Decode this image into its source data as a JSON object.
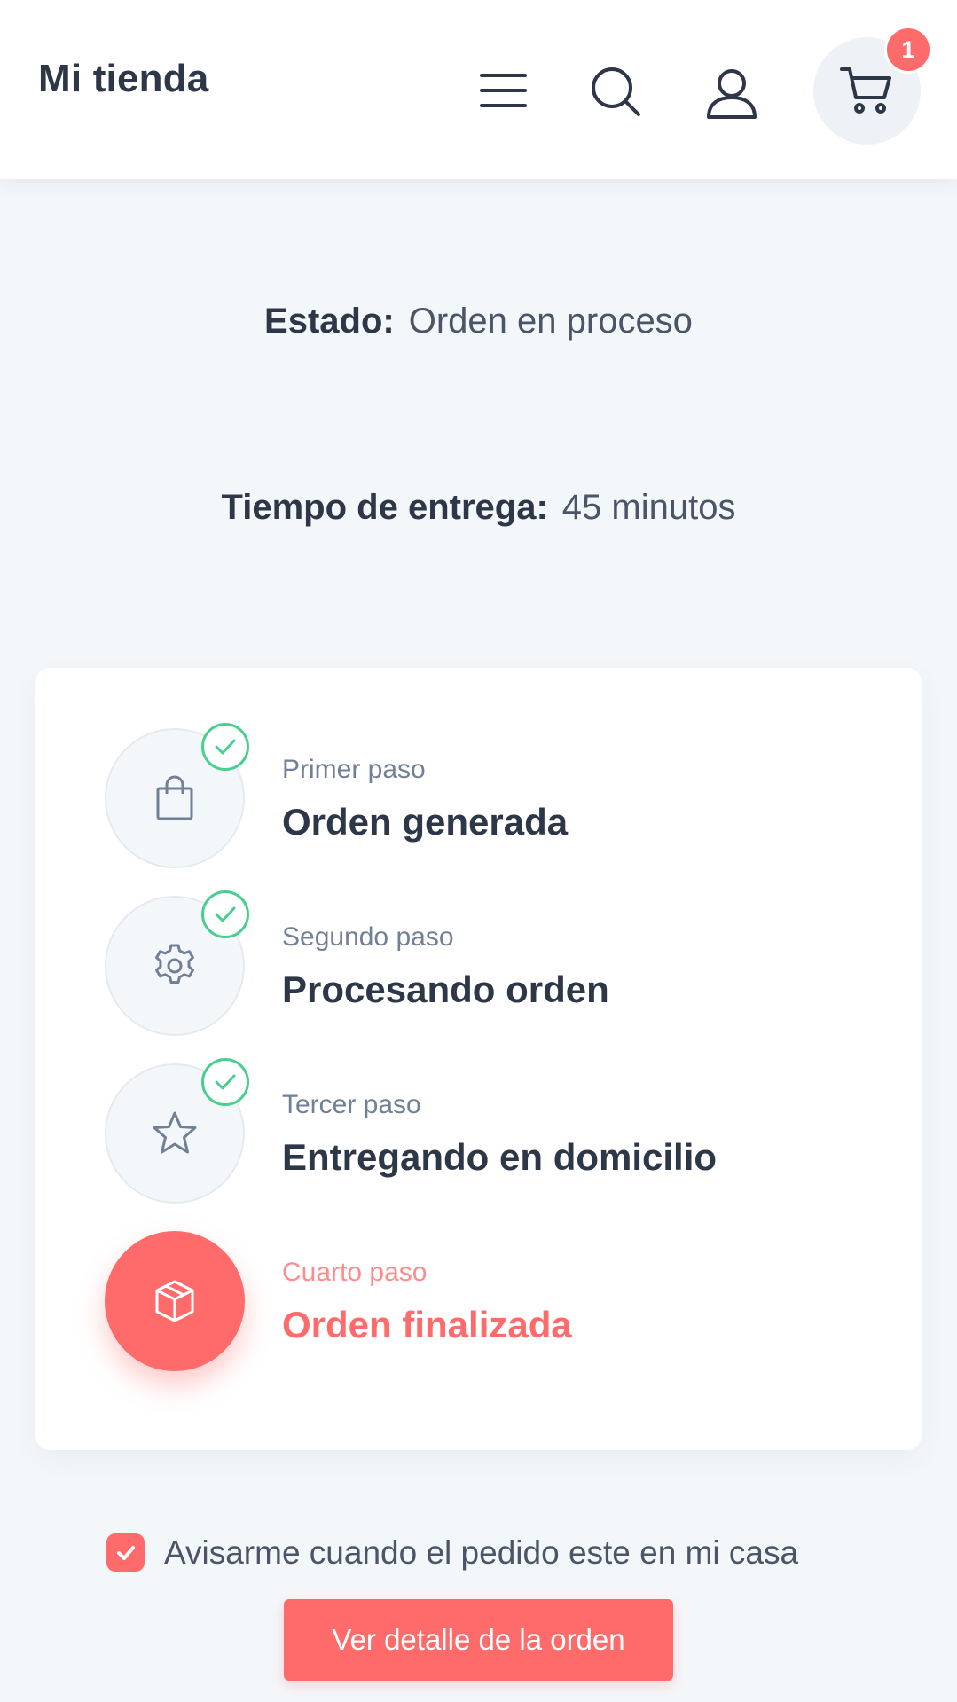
{
  "header": {
    "brand": "Mi tienda",
    "cart_count": "1"
  },
  "order": {
    "status_label": "Estado:",
    "status_value": "Orden en proceso",
    "time_label": "Tiempo de entrega:",
    "time_value": "45 minutos"
  },
  "steps": [
    {
      "subtitle": "Primer paso",
      "title": "Orden generada",
      "icon": "bag-icon",
      "completed": true
    },
    {
      "subtitle": "Segundo paso",
      "title": "Procesando orden",
      "icon": "gear-icon",
      "completed": true
    },
    {
      "subtitle": "Tercer paso",
      "title": "Entregando en domicilio",
      "icon": "star-icon",
      "completed": true
    },
    {
      "subtitle": "Cuarto paso",
      "title": "Orden finalizada",
      "icon": "box-icon",
      "completed": false,
      "active": true
    }
  ],
  "notify": {
    "label": "Avisarme cuando el pedido este en mi casa",
    "checked": true
  },
  "actions": {
    "detail_button": "Ver detalle de la orden"
  },
  "colors": {
    "accent": "#ff6b6b",
    "success": "#48cf8f",
    "text": "#2d3748",
    "muted": "#718096",
    "background": "#f4f7fa"
  }
}
